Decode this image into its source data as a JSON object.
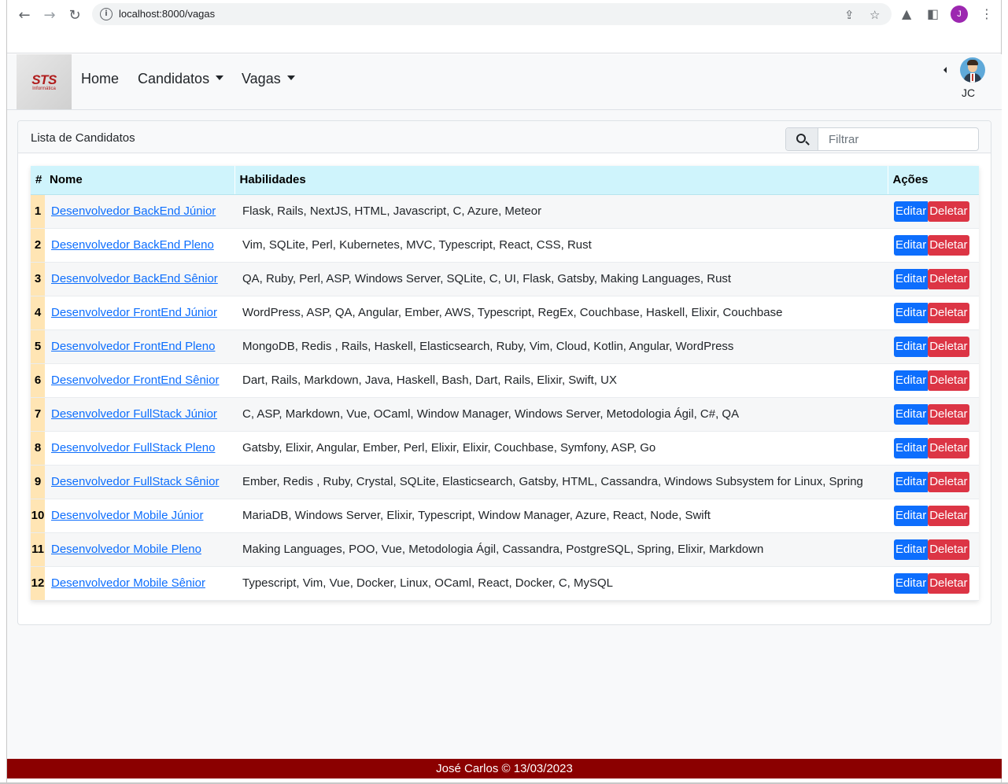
{
  "browser": {
    "url": "localhost:8000/vagas",
    "profile_initial": "J"
  },
  "navbar": {
    "logo_text": "STS",
    "logo_sub": "Informática",
    "links": [
      {
        "label": "Home"
      },
      {
        "label": "Candidatos"
      },
      {
        "label": "Vagas"
      }
    ],
    "user_label": "JC"
  },
  "card": {
    "title": "Lista de Candidatos",
    "filter_placeholder": "Filtrar"
  },
  "table": {
    "headers": [
      "#",
      "Nome",
      "Habilidades",
      "Ações"
    ],
    "edit_label": "Editar",
    "delete_label": "Deletar",
    "rows": [
      {
        "num": "1",
        "nome": "Desenvolvedor BackEnd Júnior",
        "habilidades": "Flask, Rails, NextJS, HTML, Javascript, C, Azure, Meteor"
      },
      {
        "num": "2",
        "nome": "Desenvolvedor BackEnd Pleno",
        "habilidades": "Vim, SQLite, Perl, Kubernetes, MVC, Typescript, React, CSS, Rust"
      },
      {
        "num": "3",
        "nome": "Desenvolvedor BackEnd Sênior",
        "habilidades": "QA, Ruby, Perl, ASP, Windows Server, SQLite, C, UI, Flask, Gatsby, Making Languages, Rust"
      },
      {
        "num": "4",
        "nome": "Desenvolvedor FrontEnd Júnior",
        "habilidades": "WordPress, ASP, QA, Angular, Ember, AWS, Typescript, RegEx, Couchbase, Haskell, Elixir, Couchbase"
      },
      {
        "num": "5",
        "nome": "Desenvolvedor FrontEnd Pleno",
        "habilidades": "MongoDB, Redis , Rails, Haskell, Elasticsearch, Ruby, Vim, Cloud, Kotlin, Angular, WordPress"
      },
      {
        "num": "6",
        "nome": "Desenvolvedor FrontEnd Sênior",
        "habilidades": "Dart, Rails, Markdown, Java, Haskell, Bash, Dart, Rails, Elixir, Swift, UX"
      },
      {
        "num": "7",
        "nome": "Desenvolvedor FullStack Júnior",
        "habilidades": "C, ASP, Markdown, Vue, OCaml, Window Manager, Windows Server, Metodologia Ágil, C#, QA"
      },
      {
        "num": "8",
        "nome": "Desenvolvedor FullStack Pleno",
        "habilidades": "Gatsby, Elixir, Angular, Ember, Perl, Elixir, Elixir, Couchbase, Symfony, ASP, Go"
      },
      {
        "num": "9",
        "nome": "Desenvolvedor FullStack Sênior",
        "habilidades": "Ember, Redis , Ruby, Crystal, SQLite, Elasticsearch, Gatsby, HTML, Cassandra, Windows Subsystem for Linux, Spring"
      },
      {
        "num": "10",
        "nome": "Desenvolvedor Mobile Júnior",
        "habilidades": "MariaDB, Windows Server, Elixir, Typescript, Window Manager, Azure, React, Node, Swift"
      },
      {
        "num": "11",
        "nome": "Desenvolvedor Mobile Pleno",
        "habilidades": "Making Languages, POO, Vue, Metodologia Ágil, Cassandra, PostgreSQL, Spring, Elixir, Markdown"
      },
      {
        "num": "12",
        "nome": "Desenvolvedor Mobile Sênior",
        "habilidades": "Typescript, Vim, Vue, Docker, Linux, OCaml, React, Docker, C, MySQL"
      }
    ]
  },
  "footer": {
    "text": "José Carlos © 13/03/2023"
  },
  "colors": {
    "header_bg": "#cff4fc",
    "num_bg": "#ffe5b4",
    "edit_btn": "#0d6efd",
    "delete_btn": "#dc3545",
    "footer_bg": "#8b0000"
  }
}
